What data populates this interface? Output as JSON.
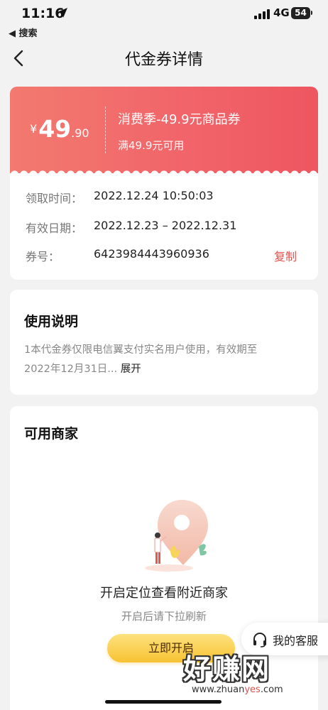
{
  "status_bar": {
    "time": "11:16",
    "back_app_label": "◀ 搜索",
    "network": "4G",
    "battery": "54"
  },
  "nav": {
    "title": "代金券详情"
  },
  "coupon": {
    "currency": "¥",
    "amount_int": "49",
    "amount_dec": ".90",
    "name": "消费季-49.9元商品券",
    "condition": "满49.9元可用",
    "claim_label": "领取时间：",
    "claim_time": "2022.12.24 10:50:03",
    "valid_label": "有效日期：",
    "valid_range": "2022.12.23 – 2022.12.31",
    "code_label": "券号：",
    "code": "6423984443960936",
    "copy_label": "复制",
    "colors": {
      "gradient_start": "#f27a6f",
      "gradient_end": "#ee5660",
      "accent": "#e4514d"
    }
  },
  "usage": {
    "title": "使用说明",
    "line1": "1本代金券仅限电信翼支付实名用户使用，有效期至",
    "line2": "2022年12月31日...",
    "expand_label": "展开"
  },
  "merchants": {
    "title": "可用商家",
    "prompt": "开启定位查看附近商家",
    "sub_prompt": "开启后请下拉刷新",
    "button_label": "立即开启"
  },
  "service": {
    "label": "我的客服",
    "icon": "headset-icon"
  },
  "watermark": {
    "big": "好赚网",
    "small_a": "www.zhuan",
    "small_b": "yes",
    "small_c": ".com"
  }
}
